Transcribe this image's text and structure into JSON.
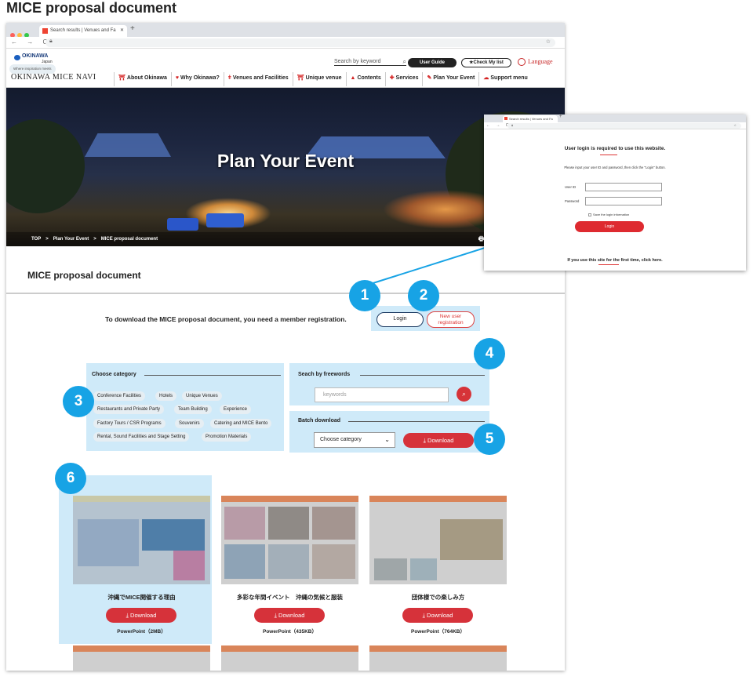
{
  "page_title": "MICE proposal document",
  "browser": {
    "tab_title": "Search results | Venues and Fa",
    "tab_close": "✕",
    "new_tab": "+",
    "nav_glyphs": "← → C"
  },
  "site": {
    "logo_text": "OKINAWA",
    "logo_sub": "Japan",
    "logo_tagline": "Where inspiration meets",
    "search_placeholder": "Search by keyword",
    "user_guide": "User Guide",
    "check_list": "★Check My list",
    "language": "Language",
    "brand": "OKINAWA MICE NAVI",
    "nav": [
      {
        "label": "About Okinawa",
        "icon": "⛩"
      },
      {
        "label": "Why Okinawa?",
        "icon": "♥"
      },
      {
        "label": "Venues and Facilities",
        "icon": "ǂ"
      },
      {
        "label": "Unique venue",
        "icon": "⛩"
      },
      {
        "label": "Contents",
        "icon": "▲"
      },
      {
        "label": "Services",
        "icon": "✚"
      },
      {
        "label": "Plan Your Event",
        "icon": "✎"
      },
      {
        "label": "Support menu",
        "icon": "☁"
      }
    ]
  },
  "hero": {
    "title": "Plan Your Event",
    "breadcrumb": [
      "TOP",
      "Plan Your Event",
      "MICE proposal document"
    ],
    "breadcrumb_sep": ">",
    "print_label": "Pr"
  },
  "section": {
    "title": "MICE proposal document",
    "download_note": "To download the MICE proposal document, you need a member registration.",
    "login": "Login",
    "new_user_line1": "New user",
    "new_user_line2": "registration"
  },
  "category": {
    "title": "Choose category",
    "tags": [
      "Conference Facilities",
      "Hotels",
      "Unique Venues",
      "Restaurants and Private Party",
      "Team Building",
      "Experience",
      "Factory Tours / CSR Programs",
      "Souvenirs",
      "Catering and MICE Bento",
      "Rental, Sound Facilities and Stage Setting",
      "Promotion Materials"
    ]
  },
  "freewords": {
    "title": "Seach by freewords",
    "placeholder": "keywords"
  },
  "batch": {
    "title": "Batch download",
    "select": "Choose category",
    "download": "Download"
  },
  "cards": [
    {
      "title": "沖縄でMICE開催する理由",
      "download": "Download",
      "size": "PowerPoint（2MB）"
    },
    {
      "title": "多彩な年間イベント　沖縄の気候と服装",
      "download": "Download",
      "size": "PowerPoint（435KB）"
    },
    {
      "title": "団体様での楽しみ方",
      "download": "Download",
      "size": "PowerPoint（764KB）"
    }
  ],
  "badges": [
    "1",
    "2",
    "3",
    "4",
    "5",
    "6"
  ],
  "popup": {
    "required": "User login is required to use this website.",
    "instruction": "Please input your user ID and password, then click the \"Login\" button.",
    "user_id": "User ID",
    "password": "Password",
    "save_login": "Save the login information",
    "login": "Login",
    "first_time": "If you use this site for the first time, click here."
  },
  "colors": {
    "accent_red": "#d6323a",
    "badge_blue": "#17a3e5",
    "highlight": "#bfe3f7"
  },
  "icons": {
    "download": "download-icon",
    "search": "search-icon",
    "globe": "globe-icon",
    "printer": "printer-icon"
  }
}
